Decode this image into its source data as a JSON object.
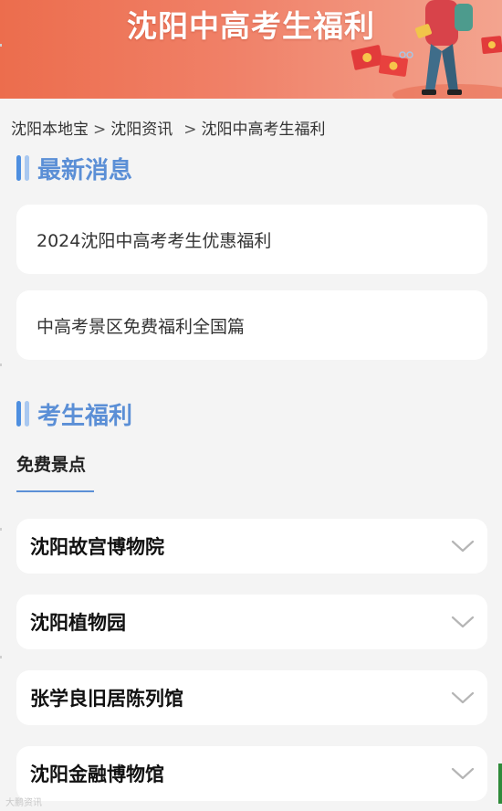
{
  "hero": {
    "title": "沈阳中高考生福利"
  },
  "breadcrumb": {
    "items": [
      "沈阳本地宝",
      "沈阳资讯",
      "沈阳中高考生福利"
    ],
    "separator": ">"
  },
  "latest_news": {
    "title": "最新消息",
    "items": [
      {
        "label": "2024沈阳中高考考生优惠福利"
      },
      {
        "label": "中高考景区免费福利全国篇"
      }
    ]
  },
  "benefits": {
    "title": "考生福利",
    "active_tab": "免费景点",
    "items": [
      {
        "label": "沈阳故宫博物院"
      },
      {
        "label": "沈阳植物园"
      },
      {
        "label": "张学良旧居陈列馆"
      },
      {
        "label": "沈阳金融博物馆"
      }
    ]
  },
  "watermark": "大鹏资讯",
  "colors": {
    "accent": "#5b8fd6",
    "hero_start": "#ec6d4d",
    "hero_end": "#f3a48f",
    "background": "#f4f4f4",
    "card": "#ffffff"
  }
}
